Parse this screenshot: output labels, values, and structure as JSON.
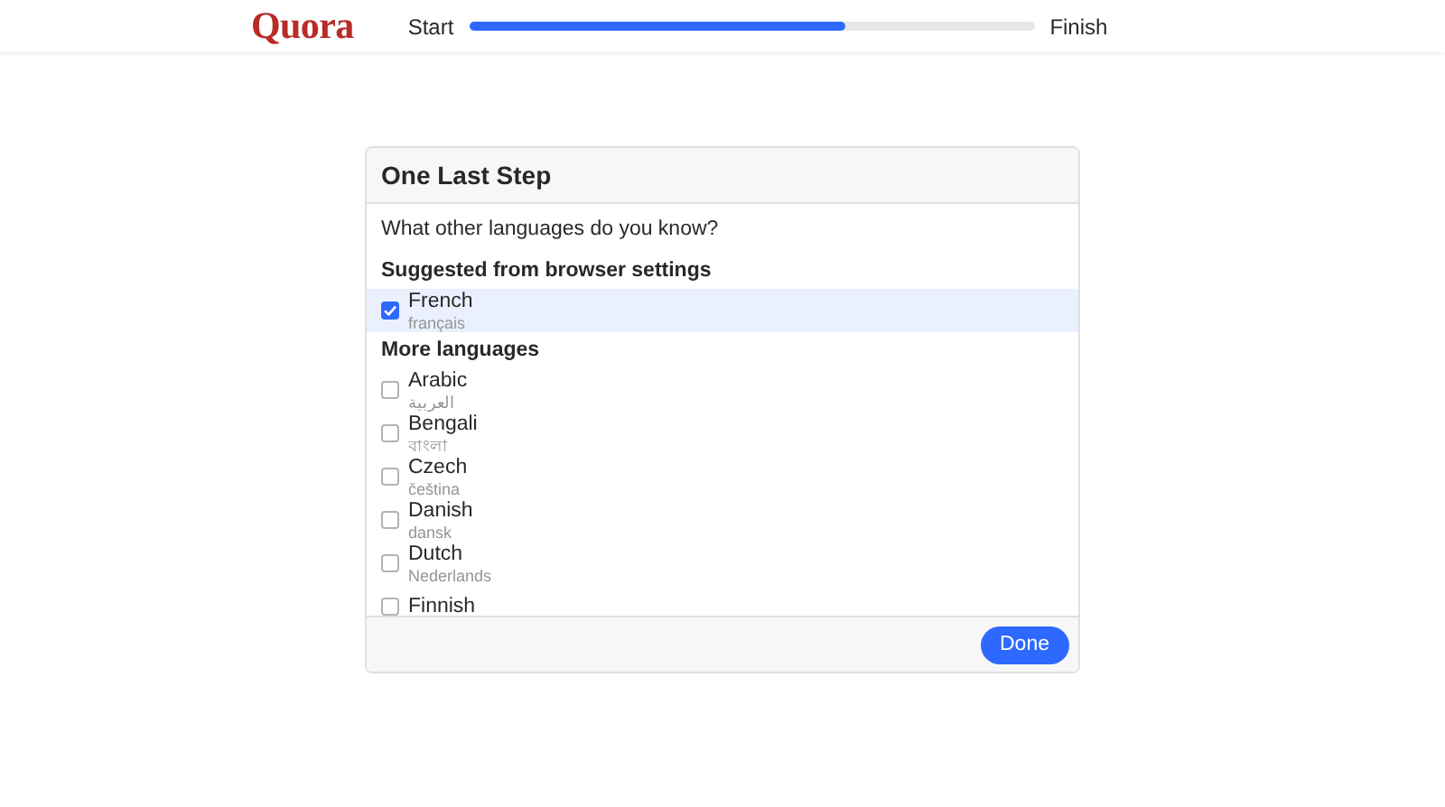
{
  "header": {
    "logo": "Quora",
    "start_label": "Start",
    "progress": {
      "level": 0.665
    },
    "finish_label": "Finish"
  },
  "dialog": {
    "title": "One Last Step",
    "question": "What other languages do you know?",
    "sections": [
      {
        "heading": "Suggested from browser settings",
        "languages": [
          {
            "name": "French",
            "native": "français",
            "checked": true
          }
        ]
      },
      {
        "heading": "More languages",
        "languages": [
          {
            "name": "Arabic",
            "native": "العربية",
            "checked": false
          },
          {
            "name": "Bengali",
            "native": "বাংলা",
            "checked": false
          },
          {
            "name": "Czech",
            "native": "čeština",
            "checked": false
          },
          {
            "name": "Danish",
            "native": "dansk",
            "checked": false
          },
          {
            "name": "Dutch",
            "native": "Nederlands",
            "checked": false
          },
          {
            "name": "Finnish",
            "checked": false
          }
        ]
      }
    ],
    "done_button": "Done"
  }
}
